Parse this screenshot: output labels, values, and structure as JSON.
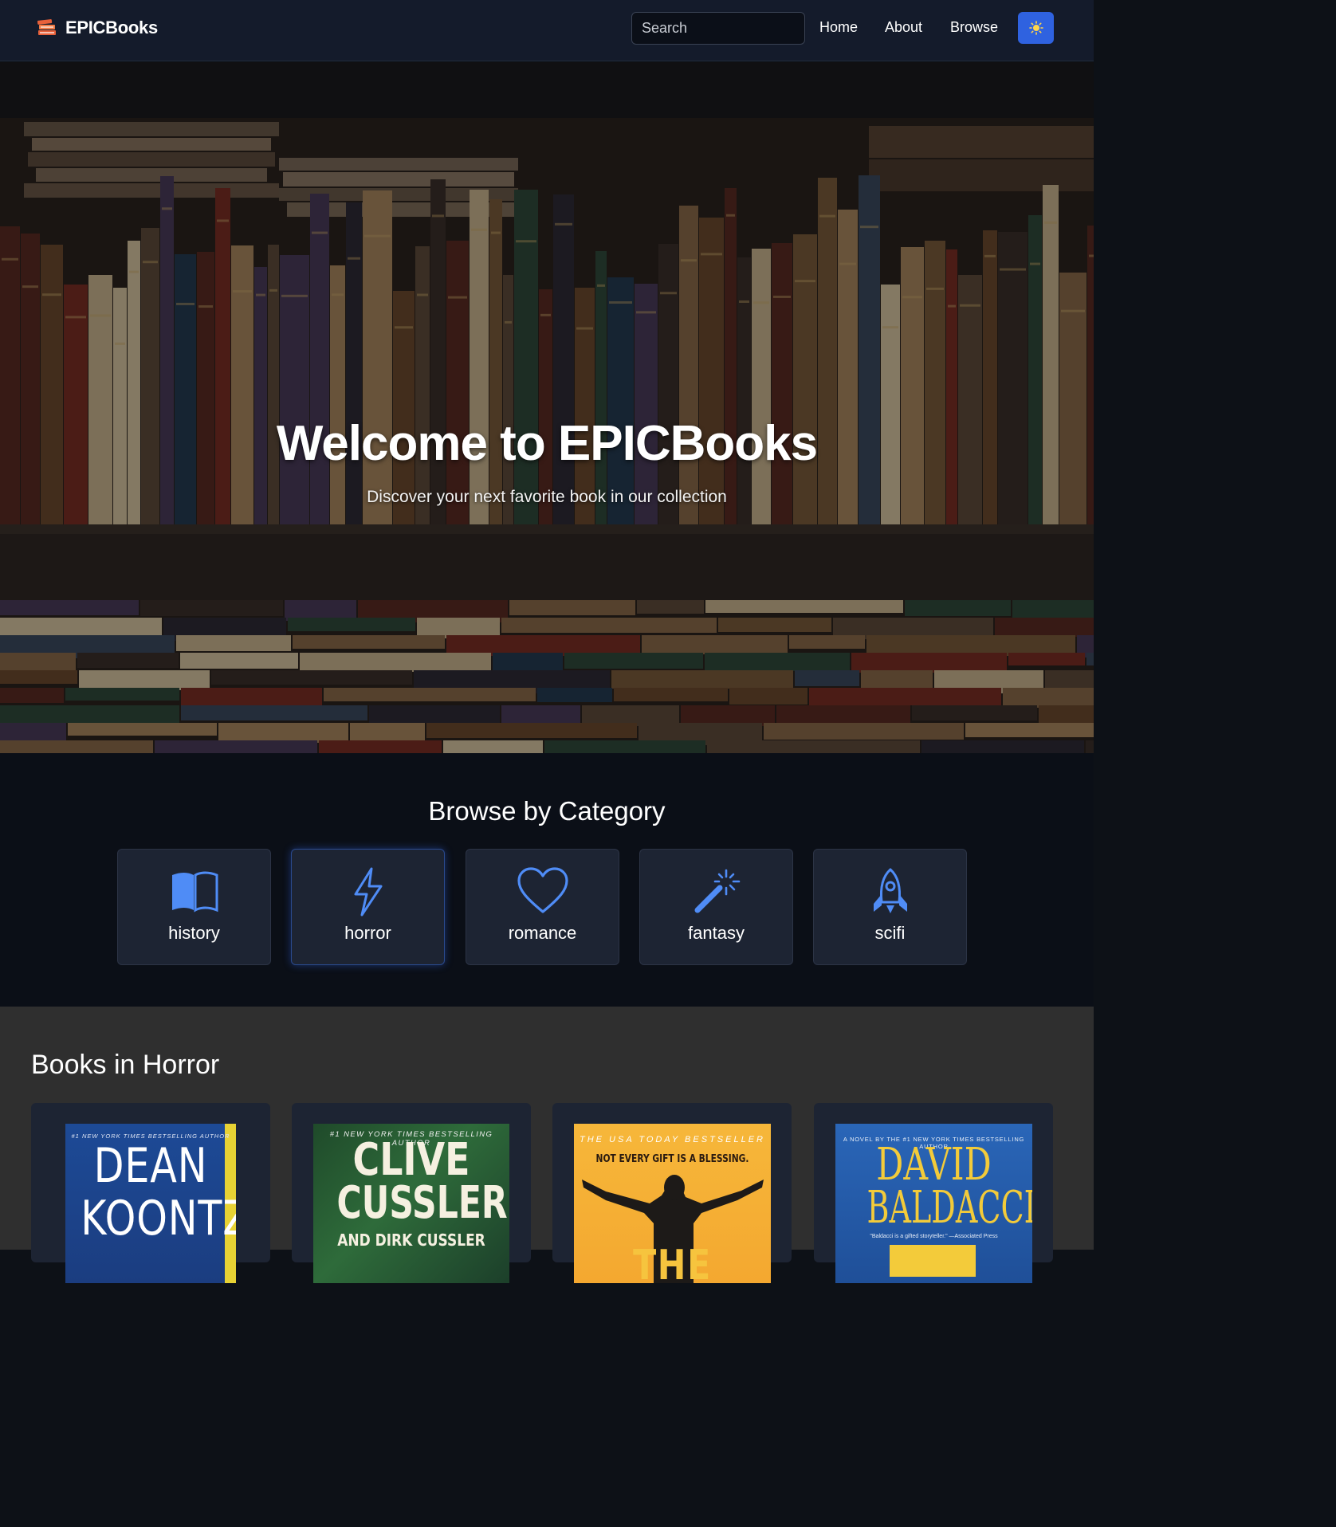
{
  "nav": {
    "brand": "EPICBooks",
    "search_placeholder": "Search",
    "links": [
      "Home",
      "About",
      "Browse"
    ],
    "theme_icon": "sun-icon"
  },
  "hero": {
    "title": "Welcome to EPICBooks",
    "subtitle": "Discover your next favorite book in our collection"
  },
  "categories": {
    "title": "Browse by Category",
    "active": "horror",
    "items": [
      {
        "label": "history",
        "icon": "open-book-icon"
      },
      {
        "label": "horror",
        "icon": "lightning-icon"
      },
      {
        "label": "romance",
        "icon": "heart-icon"
      },
      {
        "label": "fantasy",
        "icon": "magic-wand-icon"
      },
      {
        "label": "scifi",
        "icon": "rocket-icon"
      }
    ]
  },
  "books": {
    "title": "Books in Horror",
    "covers": [
      {
        "top": "#1 NEW YORK TIMES BESTSELLING AUTHOR",
        "line1": "DEAN",
        "line2": "KOONTZ"
      },
      {
        "top": "#1 NEW YORK TIMES BESTSELLING AUTHOR",
        "line1": "CLIVE",
        "line2": "CUSSLER",
        "line3": "AND DIRK CUSSLER"
      },
      {
        "top": "THE USA TODAY BESTSELLER",
        "tagline": "NOT EVERY GIFT IS A BLESSING.",
        "line1": "THE GIRL"
      },
      {
        "top": "A NOVEL BY THE #1 NEW YORK TIMES BESTSELLING AUTHOR",
        "line1": "DAVID",
        "line2": "BALDACCI",
        "quote": "\"Baldacci is a gifted storyteller.\" —Associated Press"
      }
    ]
  },
  "colors": {
    "accent": "#2f62e0",
    "icon_blue": "#4f8cf6",
    "nav_bg": "#141b2b",
    "card_bg": "#1d2433"
  }
}
